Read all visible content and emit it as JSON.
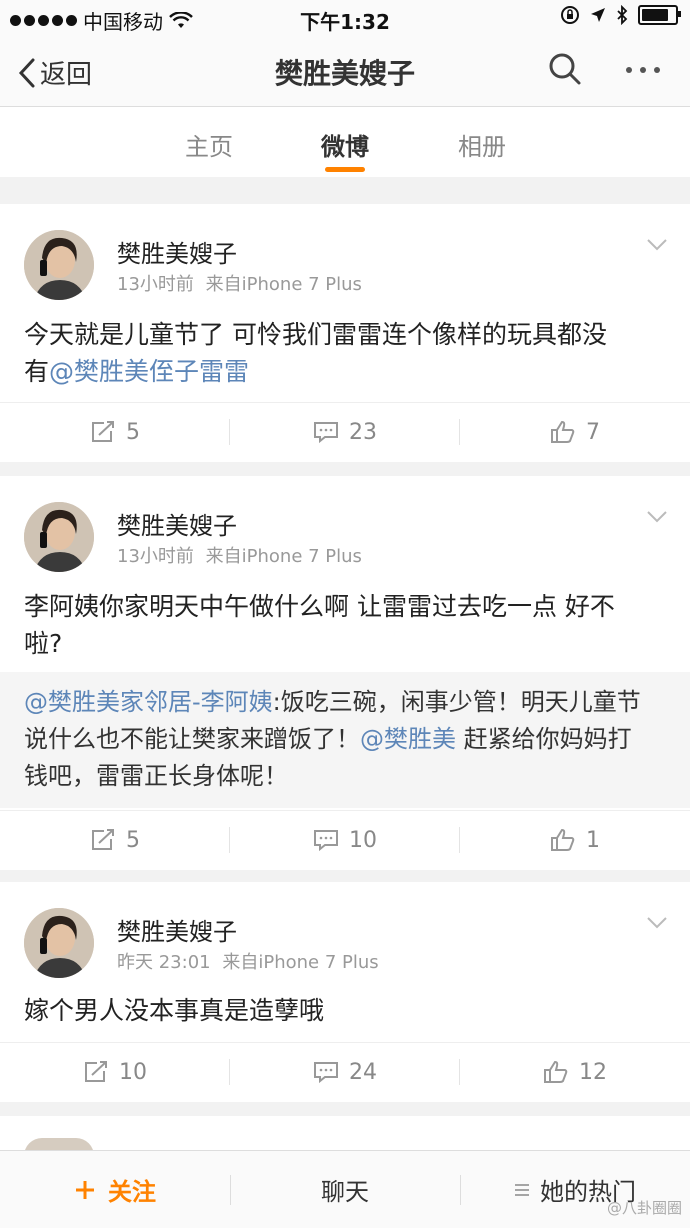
{
  "status_bar": {
    "carrier": "中国移动",
    "time": "下午1:32"
  },
  "nav": {
    "back_label": "返回",
    "title": "樊胜美嫂子"
  },
  "tabs": [
    {
      "label": "主页",
      "active": false
    },
    {
      "label": "微博",
      "active": true
    },
    {
      "label": "相册",
      "active": false
    }
  ],
  "posts": [
    {
      "username": "樊胜美嫂子",
      "time": "13小时前",
      "source": "来自iPhone 7 Plus",
      "text_line1": "今天就是儿童节了 可怜我们雷雷连个像样的玩具都没",
      "text_line2_plain": "有",
      "text_line2_mention": "@樊胜美侄子雷雷",
      "reposts": "5",
      "comments": "23",
      "likes": "7"
    },
    {
      "username": "樊胜美嫂子",
      "time": "13小时前",
      "source": "来自iPhone 7 Plus",
      "text_line1": "李阿姨你家明天中午做什么啊 让雷雷过去吃一点 好不",
      "text_line2": "啦?",
      "repost": {
        "mention1": "@樊胜美家邻居-李阿姨",
        "line1_rest": ":饭吃三碗，闲事少管！明天儿童节",
        "line2_plain": "说什么也不能让樊家来蹭饭了！",
        "mention2": "@樊胜美",
        "line2_rest": " 赶紧给你妈妈打",
        "line3": "钱吧，雷雷正长身体呢！"
      },
      "reposts": "5",
      "comments": "10",
      "likes": "1"
    },
    {
      "username": "樊胜美嫂子",
      "time": "昨天 23:01",
      "source": "来自iPhone 7 Plus",
      "text_line1": "嫁个男人没本事真是造孽哦",
      "reposts": "10",
      "comments": "24",
      "likes": "12"
    }
  ],
  "bottom_bar": {
    "follow_label": "关注",
    "chat_label": "聊天",
    "hot_label": "她的热门"
  },
  "watermark": "@八卦圈圈",
  "colors": {
    "accent": "#ff8200",
    "mention": "#5d86b8"
  }
}
